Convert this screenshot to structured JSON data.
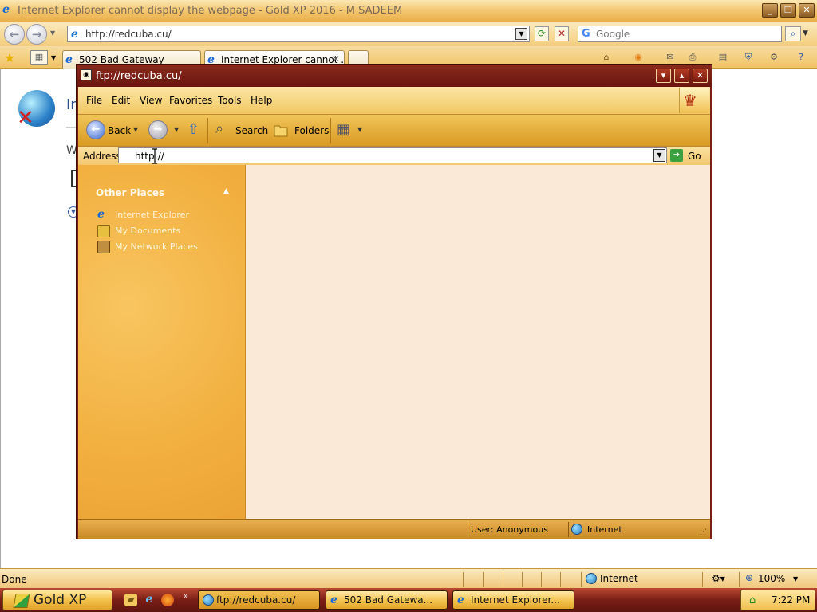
{
  "ie": {
    "title": "Internet Explorer cannot display the webpage - Gold XP 2016 - M SADEEM",
    "address": "http://redcuba.cu/",
    "search_placeholder": "Google",
    "tabs": [
      {
        "label": "502 Bad Gateway"
      },
      {
        "label": "Internet Explorer cannot ..."
      }
    ],
    "content": {
      "title_fragment": "In",
      "text_fragment": "W"
    },
    "status": {
      "text": "Done",
      "zone": "Internet",
      "zoom": "100%"
    }
  },
  "ftp": {
    "title": "ftp://redcuba.cu/",
    "menu": [
      "File",
      "Edit",
      "View",
      "Favorites",
      "Tools",
      "Help"
    ],
    "toolbar": {
      "back": "Back",
      "search": "Search",
      "folders": "Folders"
    },
    "address_label": "Address",
    "address_value": "http://",
    "go": "Go",
    "sidebar": {
      "panel_title": "Other Places",
      "links": [
        "Internet Explorer",
        "My Documents",
        "My Network Places"
      ]
    },
    "status": {
      "user": "User: Anonymous",
      "zone": "Internet"
    }
  },
  "taskbar": {
    "start": "Gold XP",
    "buttons": [
      "ftp://redcuba.cu/",
      "502 Bad Gatewa...",
      "Internet Explorer..."
    ],
    "clock": "7:22 PM"
  },
  "colors": {
    "accent_gold": "#f2c24e",
    "window_frame": "#7a1f16",
    "content_bg": "#fae9d6"
  }
}
